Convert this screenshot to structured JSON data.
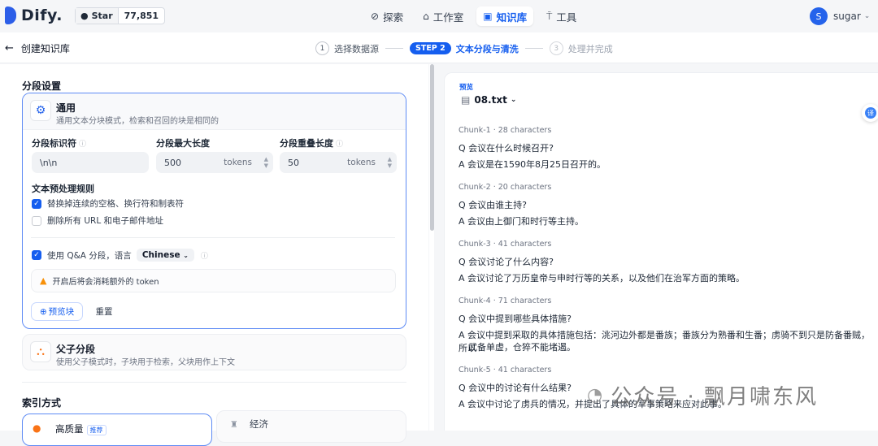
{
  "brand": {
    "name": "Dify."
  },
  "github": {
    "star_label": "Star",
    "star_count": "77,851"
  },
  "nav": [
    {
      "label": "探索",
      "icon": "compass-icon",
      "glyph": "⊘"
    },
    {
      "label": "工作室",
      "icon": "robot-icon",
      "glyph": "⌂"
    },
    {
      "label": "知识库",
      "icon": "book-icon",
      "glyph": "▣"
    },
    {
      "label": "工具",
      "icon": "tool-icon",
      "glyph": "⍑"
    }
  ],
  "user": {
    "initial": "S",
    "name": "sugar"
  },
  "back": {
    "label": "创建知识库"
  },
  "steps": [
    {
      "num": "1",
      "label": "选择数据源"
    },
    {
      "pill": "STEP 2",
      "label": "文本分段与清洗"
    },
    {
      "num": "3",
      "label": "处理并完成"
    }
  ],
  "segment": {
    "title": "分段设置",
    "general": {
      "title": "通用",
      "desc": "通用文本分块模式，检索和召回的块是相同的",
      "delimiter_label": "分段标识符",
      "delimiter_value": "\\n\\n",
      "maxlen_label": "分段最大长度",
      "maxlen_value": "500",
      "overlap_label": "分段重叠长度",
      "overlap_value": "50",
      "unit": "tokens",
      "rules_title": "文本预处理规则",
      "rule1": "替换掉连续的空格、换行符和制表符",
      "rule1_checked": true,
      "rule2": "删除所有 URL 和电子邮件地址",
      "rule2_checked": false,
      "qa_label": "使用 Q&A 分段，语言",
      "qa_checked": true,
      "qa_lang": "Chinese",
      "warning": "开启后将会消耗额外的 token",
      "preview_btn": "预览块",
      "reset_btn": "重置"
    },
    "parent_child": {
      "title": "父子分段",
      "desc": "使用父子模式时，子块用于检索，父块用作上下文"
    }
  },
  "index": {
    "title": "索引方式",
    "high": "高质量",
    "recommended": "推荐",
    "economy": "经济"
  },
  "preview": {
    "label": "预览",
    "file": "08.txt",
    "chunks": [
      {
        "meta": "Chunk-1 · 28 characters",
        "q": "Q 会议在什么时候召开?",
        "a": "A 会议是在1590年8月25日召开的。",
        "a2": ""
      },
      {
        "meta": "Chunk-2 · 20 characters",
        "q": "Q 会议由谁主持?",
        "a": "A 会议由上御门和时行等主持。",
        "a2": ""
      },
      {
        "meta": "Chunk-3 · 41 characters",
        "q": "Q 会议讨论了什么内容?",
        "a": "A 会议讨论了万历皇帝与申时行等的关系，以及他们在治军方面的策略。",
        "a2": ""
      },
      {
        "meta": "Chunk-4 · 71 characters",
        "q": "Q 会议中提到哪些具体措施?",
        "a": "A 会议中提到采取的具体措施包括：洮河边外都是番族；番族分为熟番和生番；虏骑不到只是防备番贼，所以",
        "a2": "武备单虚，仓猝不能堵遏。"
      },
      {
        "meta": "Chunk-5 · 41 characters",
        "q": "Q 会议中的讨论有什么结果?",
        "a": "A 会议中讨论了虏兵的情况，并提出了具体的军事策略来应对此事。",
        "a2": ""
      }
    ]
  },
  "float_button": {
    "label": "译"
  },
  "watermark": {
    "text": "公众号 · 飘月啸东风"
  }
}
